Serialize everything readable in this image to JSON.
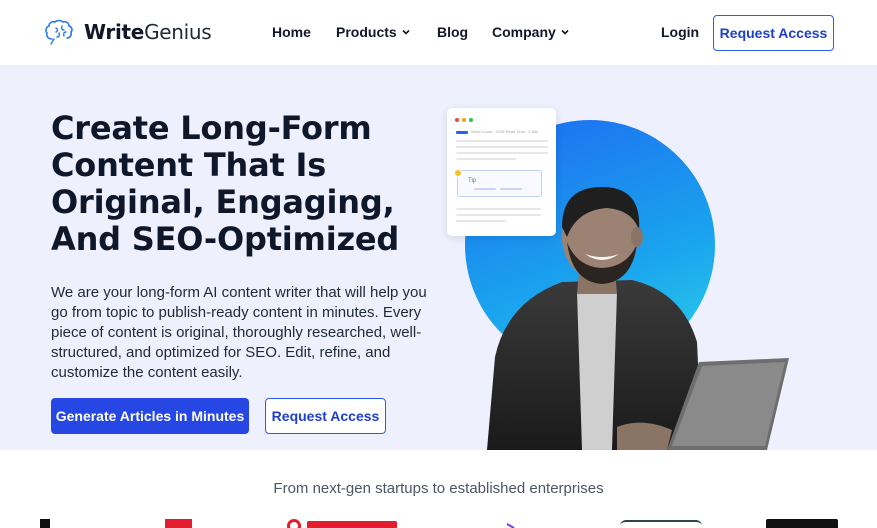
{
  "nav": {
    "logo_prefix": "Write",
    "logo_suffix": "Genius",
    "items": [
      {
        "label": "Home",
        "has_dropdown": false
      },
      {
        "label": "Products",
        "has_dropdown": true
      },
      {
        "label": "Blog",
        "has_dropdown": false
      },
      {
        "label": "Company",
        "has_dropdown": true
      }
    ],
    "login": "Login",
    "request_access": "Request Access"
  },
  "hero": {
    "title": "Create Long-Form Content That Is Original, Engaging, And SEO-Optimized",
    "description": "We are your long-form AI content writer that will help you go from topic to publish-ready content in minutes. Every piece of content is original, thoroughly researched, well-structured, and optimized for SEO. Edit, refine, and customize the content easily.",
    "primary_cta": "Generate Articles in Minutes",
    "secondary_cta": "Request Access",
    "card": {
      "meta": "Word Count : 4128   Read Time : 2 Min",
      "tip_label": "Tip"
    }
  },
  "trust": {
    "tagline": "From next-gen startups to established enterprises"
  },
  "colors": {
    "primary": "#2747e4",
    "hero_bg": "#eef0fd",
    "circle_start": "#1d6cf0",
    "circle_end": "#2ed3e8"
  }
}
